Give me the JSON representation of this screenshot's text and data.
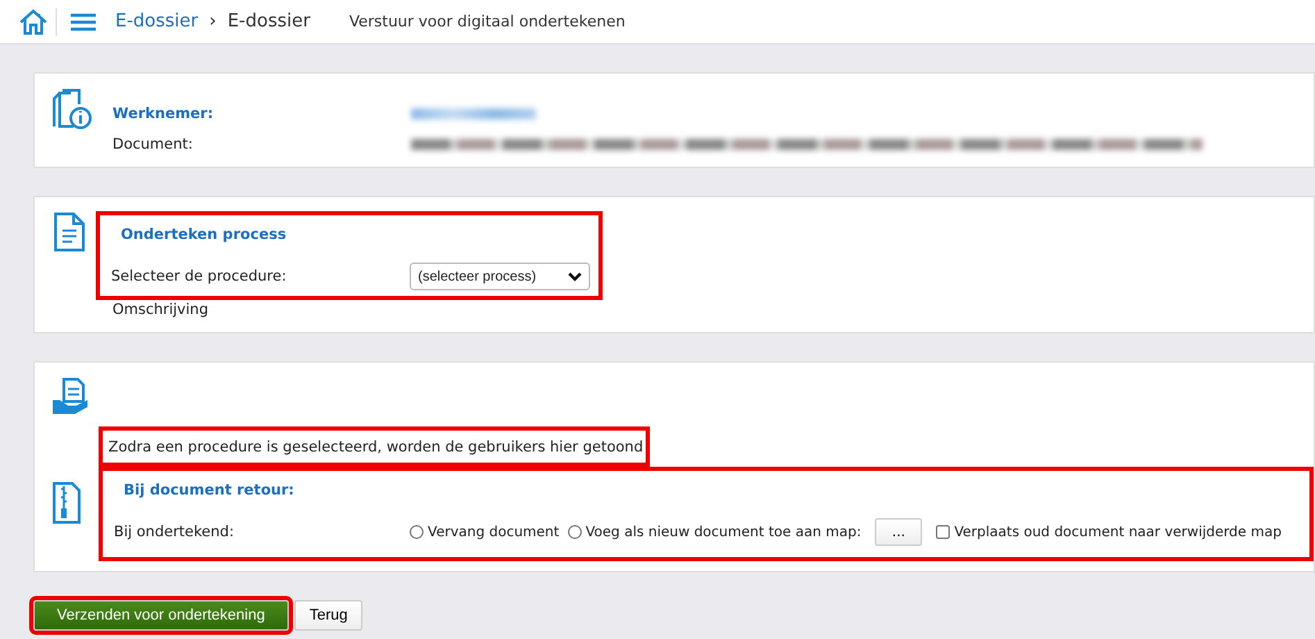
{
  "breadcrumb": [
    {
      "label": "E-dossier",
      "link": true
    },
    {
      "label": "E-dossier",
      "link": false
    }
  ],
  "separator": "›",
  "page_title": "Verstuur voor digitaal ondertekenen",
  "info_card": {
    "fields": [
      {
        "label": "Werknemer:",
        "emphasis": true,
        "redacted": true
      },
      {
        "label": "Document:",
        "emphasis": false,
        "redacted": true
      }
    ]
  },
  "process_card": {
    "title": "Onderteken process",
    "highlighted": true,
    "select_label": "Selecteer de procedure:",
    "select_value": "(selecteer process)",
    "description": "Omschrijving"
  },
  "users_card": {
    "message": "Zodra een procedure is geselecteerd, worden de gebruikers hier getoond",
    "message_highlighted": true,
    "return_section": {
      "title": "Bij document retour:",
      "highlighted": true,
      "row_label": "Bij ondertekend:",
      "options": [
        {
          "kind": "radio",
          "label": "Vervang document",
          "selected": false
        },
        {
          "kind": "radio",
          "label": "Voeg als nieuw document toe aan map:",
          "selected": false
        },
        {
          "kind": "browse",
          "label": "..."
        },
        {
          "kind": "checkbox",
          "label": "Verplaats oud document naar verwijderde map",
          "checked": false
        }
      ]
    }
  },
  "buttons": [
    {
      "label": "Verzenden voor ondertekening",
      "kind": "primary",
      "highlighted": true
    },
    {
      "label": "Terug",
      "kind": "secondary",
      "highlighted": false
    }
  ]
}
